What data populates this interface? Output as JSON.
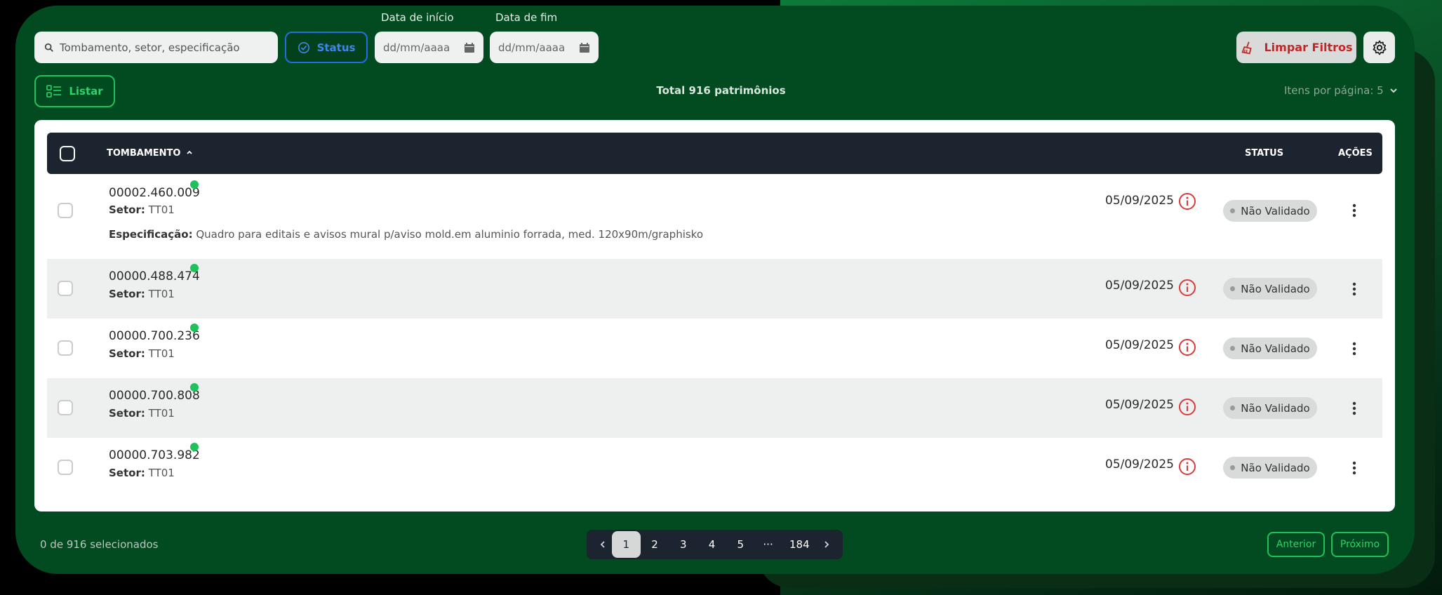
{
  "filters": {
    "search_placeholder": "Tombamento, setor, especificação",
    "status_label": "Status",
    "date_start_label": "Data de início",
    "date_end_label": "Data de fim",
    "date_placeholder": "dd/mm/aaaa",
    "clear_label": "Limpar Filtros"
  },
  "toolbar": {
    "list_label": "Listar",
    "total_text": "Total 916 patrimônios",
    "per_page_text": "Itens por página: 5"
  },
  "table": {
    "headers": {
      "tombamento": "TOMBAMENTO",
      "status": "STATUS",
      "acoes": "AÇÕES"
    },
    "setor_label": "Setor:",
    "espec_label": "Especificação:",
    "rows": [
      {
        "tombamento": "00002.460.009",
        "setor": "TT01",
        "especificacao": "Quadro para editais e avisos mural p/aviso mold.em aluminio forrada, med. 120x90m/graphisko",
        "date": "05/09/2025",
        "status": "Não Validado"
      },
      {
        "tombamento": "00000.488.474",
        "setor": "TT01",
        "date": "05/09/2025",
        "status": "Não Validado"
      },
      {
        "tombamento": "00000.700.236",
        "setor": "TT01",
        "date": "05/09/2025",
        "status": "Não Validado"
      },
      {
        "tombamento": "00000.700.808",
        "setor": "TT01",
        "date": "05/09/2025",
        "status": "Não Validado"
      },
      {
        "tombamento": "00000.703.982",
        "setor": "TT01",
        "date": "05/09/2025",
        "status": "Não Validado"
      }
    ]
  },
  "footer": {
    "selected_text": "0 de 916 selecionados",
    "pages": [
      "1",
      "2",
      "3",
      "4",
      "5",
      "···",
      "184"
    ],
    "prev_label": "Anterior",
    "next_label": "Próximo"
  },
  "colors": {
    "panel": "#024a20",
    "accent_green": "#1fc25a",
    "status_blue": "#1e6fe0",
    "danger_red": "#c02828",
    "header_dark": "#1c2430"
  }
}
